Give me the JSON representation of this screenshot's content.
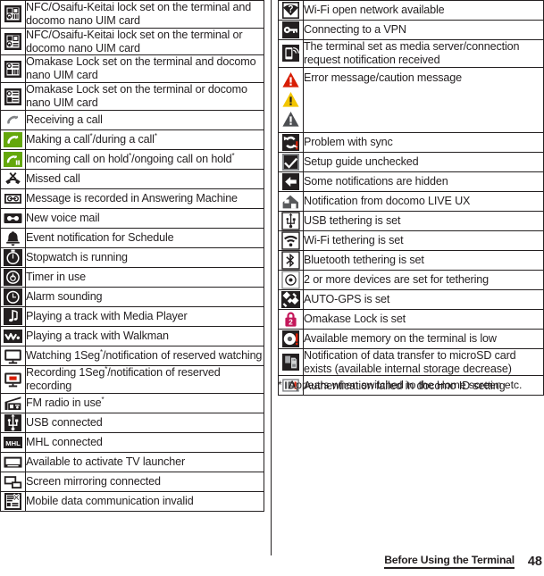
{
  "page": {
    "footer_chapter": "Before Using the Terminal",
    "footer_page_number": "48"
  },
  "footnote": {
    "marker": "*",
    "text": "Appears when switched to the Home screen etc."
  },
  "colors": {
    "ink": "#231f20",
    "call_green": "#64a70b",
    "alert_red": "#d81e05",
    "alert_yellow": "#f2c500",
    "alert_gray": "#58595b",
    "lock_magenta": "#c4175a"
  },
  "left_table": {
    "rows": [
      {
        "icon": "nfc-osaifu-keitai-lock-both-icon",
        "text": "NFC/Osaifu-Keitai lock set on the terminal and docomo nano UIM card"
      },
      {
        "icon": "nfc-osaifu-keitai-lock-either-icon",
        "text": "NFC/Osaifu-Keitai lock set on the terminal or docomo nano UIM card"
      },
      {
        "icon": "omakase-lock-both-icon",
        "text": "Omakase Lock set on the terminal and docomo nano UIM card"
      },
      {
        "icon": "omakase-lock-either-icon",
        "text": "Omakase Lock set on the terminal or docomo nano UIM card"
      },
      {
        "icon": "receiving-call-icon",
        "text": "Receiving a call"
      },
      {
        "icon": "making-call-icon",
        "text": "Making a call*/during a call*",
        "html": "Making a call<sup>*</sup>/during a call<sup>*</sup>"
      },
      {
        "icon": "call-on-hold-icon",
        "text": "Incoming call on hold*/ongoing call on hold*",
        "html": "Incoming call on hold<sup>*</sup>/ongoing call on hold<sup>*</sup>"
      },
      {
        "icon": "missed-call-icon",
        "text": "Missed call"
      },
      {
        "icon": "answering-machine-icon",
        "text": "Message is recorded in Answering Machine"
      },
      {
        "icon": "new-voice-mail-icon",
        "text": "New voice mail"
      },
      {
        "icon": "schedule-event-bell-icon",
        "text": "Event notification for Schedule"
      },
      {
        "icon": "stopwatch-icon",
        "text": "Stopwatch is running"
      },
      {
        "icon": "timer-icon",
        "text": "Timer in use"
      },
      {
        "icon": "alarm-clock-icon",
        "text": "Alarm sounding"
      },
      {
        "icon": "media-player-note-icon",
        "text": "Playing a track with Media Player"
      },
      {
        "icon": "walkman-icon",
        "text": "Playing a track with Walkman"
      },
      {
        "icon": "watching-1seg-icon",
        "text": "Watching 1Seg*/notification of reserved watching",
        "html": "Watching 1Seg<sup>*</sup>/notification of reserved watching"
      },
      {
        "icon": "recording-1seg-icon",
        "text": "Recording 1Seg*/notification of reserved recording",
        "html": "Recording 1Seg<sup>*</sup>/notification of reserved recording"
      },
      {
        "icon": "fm-radio-icon",
        "text": "FM radio in use*",
        "html": "FM radio in use<sup>*</sup>"
      },
      {
        "icon": "usb-connected-icon",
        "text": "USB connected"
      },
      {
        "icon": "mhl-connected-icon",
        "text": "MHL connected"
      },
      {
        "icon": "tv-launcher-icon",
        "text": "Available to activate TV launcher"
      },
      {
        "icon": "screen-mirroring-icon",
        "text": "Screen mirroring connected"
      },
      {
        "icon": "mobile-data-invalid-icon",
        "text": "Mobile data communication invalid"
      }
    ]
  },
  "right_table": {
    "rows": [
      {
        "icon": "wifi-open-network-icon",
        "text": "Wi-Fi open network available"
      },
      {
        "icon": "vpn-key-icon",
        "text": "Connecting to a VPN"
      },
      {
        "icon": "media-server-icon",
        "text": "The terminal set as media server/connection request notification received"
      },
      {
        "icon": "error-caution-triangles-icon",
        "text": "Error message/caution message"
      },
      {
        "icon": "sync-problem-icon",
        "text": "Problem with sync"
      },
      {
        "icon": "setup-guide-check-icon",
        "text": "Setup guide unchecked"
      },
      {
        "icon": "hidden-notifications-icon",
        "text": "Some notifications are hidden"
      },
      {
        "icon": "docomo-live-ux-home-icon",
        "text": "Notification from docomo LIVE UX"
      },
      {
        "icon": "usb-tethering-icon",
        "text": "USB tethering is set"
      },
      {
        "icon": "wifi-tethering-icon",
        "text": "Wi-Fi tethering is set"
      },
      {
        "icon": "bluetooth-tethering-icon",
        "text": "Bluetooth tethering is set"
      },
      {
        "icon": "multi-device-tethering-icon",
        "text": "2 or more devices are set for tethering"
      },
      {
        "icon": "auto-gps-icon",
        "text": "AUTO-GPS is set"
      },
      {
        "icon": "omakase-lock-set-icon",
        "text": "Omakase Lock is set"
      },
      {
        "icon": "low-memory-icon",
        "text": "Available memory on the terminal is low"
      },
      {
        "icon": "microsd-transfer-icon",
        "text": "Notification of data transfer to microSD card exists (available internal storage decrease)"
      },
      {
        "icon": "docomo-id-auth-failed-icon",
        "text": "Authentication failed in docomo ID setting"
      }
    ]
  }
}
